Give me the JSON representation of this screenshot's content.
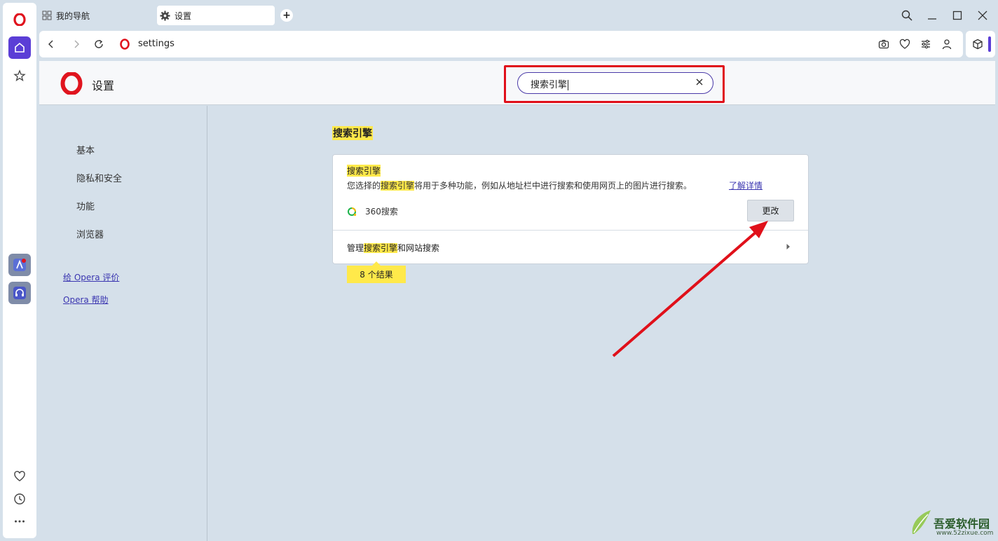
{
  "browser": {
    "tabs": [
      {
        "label": "我的导航",
        "icon": "grid-icon"
      },
      {
        "label": "设置",
        "icon": "gear-icon",
        "active": true
      }
    ],
    "new_tab_label": "+",
    "url": "settings"
  },
  "settings": {
    "header_title": "设置",
    "search": {
      "value": "搜索引擎"
    },
    "nav": {
      "items": [
        "基本",
        "隐私和安全",
        "功能",
        "浏览器"
      ],
      "links": [
        "给 Opera 评价",
        "Opera 帮助"
      ]
    },
    "section_title": "搜索引擎",
    "card": {
      "title": "搜索引擎",
      "desc_before": "您选择的",
      "desc_highlight": "搜索引擎",
      "desc_after": "将用于多种功能，例如从地址栏中进行搜索和使用网页上的图片进行搜索。",
      "learn_more": "了解详情",
      "engine_name": "360搜索",
      "change_button": "更改",
      "manage_before": "管理",
      "manage_highlight": "搜索引擎",
      "manage_after": "和网站搜索"
    },
    "results_tip": "8 个结果"
  },
  "watermark": {
    "name": "吾爱软件园",
    "url": "www.52zixue.com"
  },
  "colors": {
    "highlight": "#ffe94a",
    "annotation_red": "#e0101a",
    "accent": "#4a3aa8",
    "opera_red": "#e0141e"
  }
}
